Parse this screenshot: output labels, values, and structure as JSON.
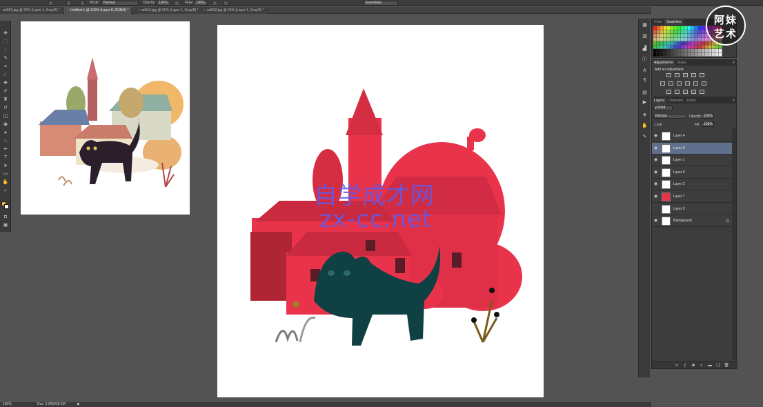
{
  "options_bar": {
    "mode_label": "Mode:",
    "mode_value": "Normal",
    "opacity_label": "Opacity:",
    "opacity_value": "100%",
    "flow_label": "Flow:",
    "flow_value": "100%",
    "workspace_value": "Essentials"
  },
  "tabs": [
    {
      "label": "art502.jpg @ 25% (Layer 1, Gray/8) *",
      "active": false
    },
    {
      "label": "Untitled-1 @ 100% (Layer 8, RGB/8) *",
      "active": true
    },
    {
      "label": "art616.jpg @ 50% (Layer 1, Gray/8) *",
      "active": false
    },
    {
      "label": "art502.jpg @ 25% (Layer 1, Gray/8) *",
      "active": false
    }
  ],
  "watermark": {
    "chinese_text": "自学成才网",
    "url_text": "zx-cc.net"
  },
  "logo": {
    "line1": "阿妹",
    "line2": "艺术"
  },
  "swatches_panel": {
    "tabs": [
      "Color",
      "Swatches"
    ],
    "active_tab": "Swatches"
  },
  "adjustments_panel": {
    "tabs": [
      "Adjustments",
      "Styles"
    ],
    "active_tab": "Adjustments",
    "title": "Add an adjustment"
  },
  "layers_panel": {
    "tabs": [
      "Layers",
      "Channels",
      "Paths"
    ],
    "active_tab": "Layers",
    "filter_value": "ρ Kind",
    "blend_mode": "Normal",
    "opacity_label": "Opacity:",
    "opacity_value": "100%",
    "lock_label": "Lock:",
    "fill_label": "Fill:",
    "fill_value": "100%",
    "layers": [
      {
        "name": "Layer 4",
        "selected": false,
        "visible": true
      },
      {
        "name": "Layer 8",
        "selected": true,
        "visible": true
      },
      {
        "name": "Layer 1",
        "selected": false,
        "visible": true
      },
      {
        "name": "Layer 6",
        "selected": false,
        "visible": true
      },
      {
        "name": "Layer 2",
        "selected": false,
        "visible": true
      },
      {
        "name": "Layer 7",
        "selected": false,
        "visible": true
      },
      {
        "name": "Layer 5",
        "selected": false,
        "visible": false
      },
      {
        "name": "Background",
        "selected": false,
        "visible": true,
        "locked": true
      }
    ]
  },
  "status_bar": {
    "zoom": "100%",
    "doc_info": "Doc: 3.60M/30.2M"
  },
  "colors": {
    "foreground": "#f0b23a",
    "background": "#ffffff",
    "accent_selected_layer": "#5f6f8c",
    "illustration_red": "#e8334a",
    "cat_teal": "#0f4043"
  }
}
